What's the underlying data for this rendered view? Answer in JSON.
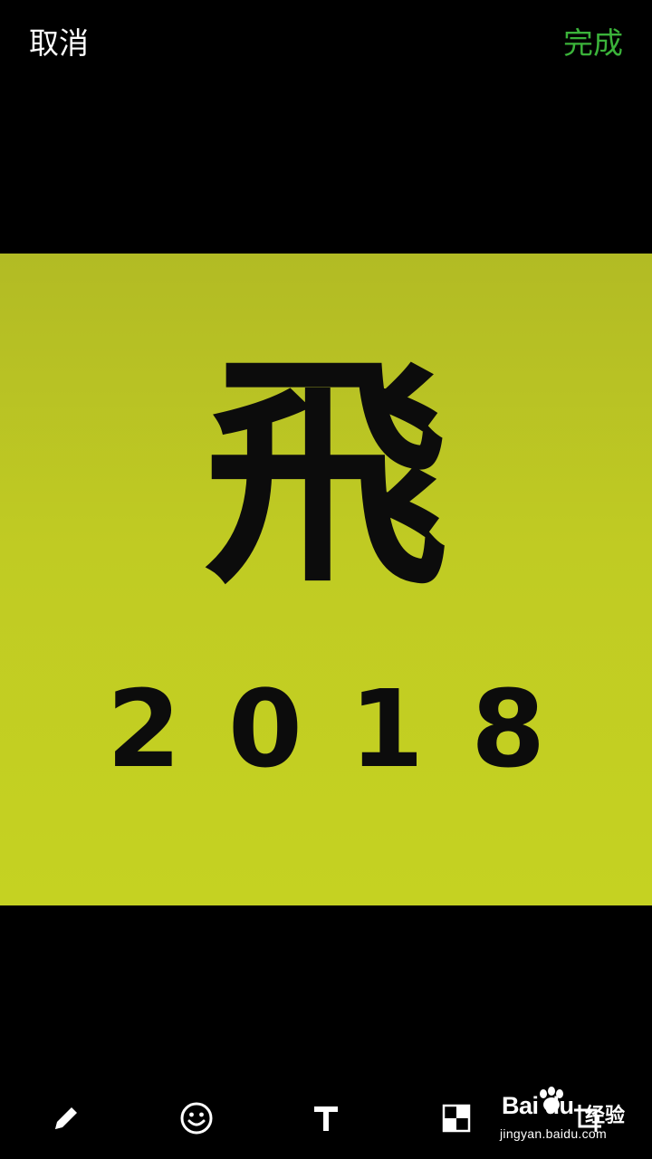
{
  "header": {
    "cancel_label": "取消",
    "done_label": "完成"
  },
  "image": {
    "character": "飛",
    "year": "2018",
    "background_top": "#b2bb24",
    "background_bottom": "#c5d222",
    "text_color": "#0c0c0c"
  },
  "toolbar": {
    "tools": [
      "pencil-icon",
      "emoji-icon",
      "text-icon",
      "mosaic-icon",
      "crop-icon"
    ]
  },
  "watermark": {
    "logo": "Bai du",
    "word": "经验",
    "url": "jingyan.baidu.com"
  },
  "colors": {
    "accent": "#3bb33a",
    "background": "#000000"
  }
}
